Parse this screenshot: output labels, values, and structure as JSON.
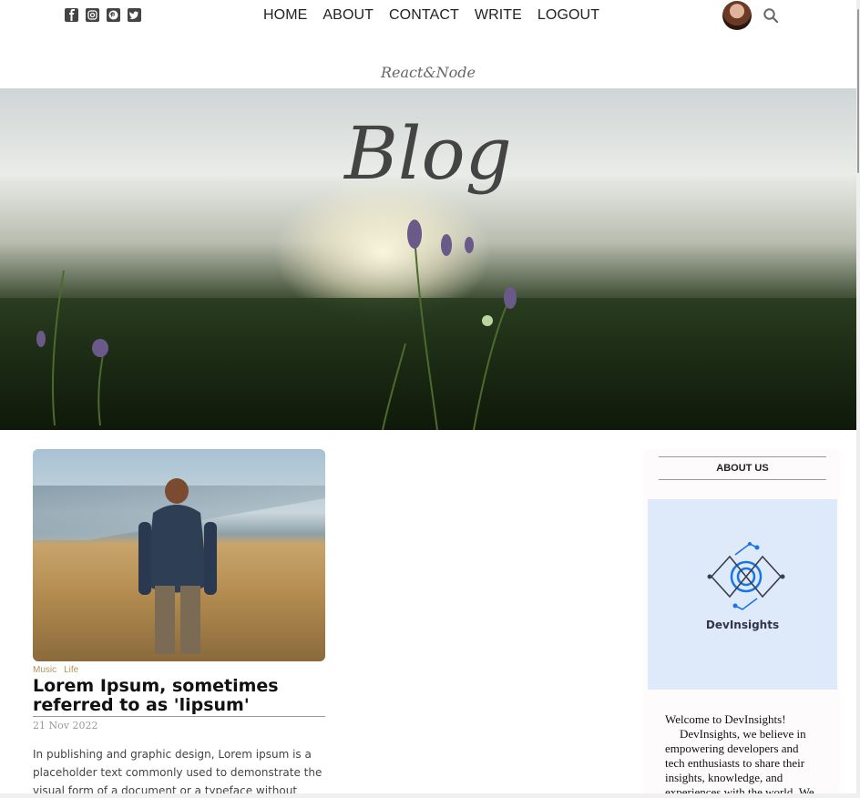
{
  "social": {
    "icons": [
      "facebook-icon",
      "instagram-icon",
      "pinterest-icon",
      "twitter-icon"
    ]
  },
  "nav": {
    "items": [
      "HOME",
      "ABOUT",
      "CONTACT",
      "WRITE",
      "LOGOUT"
    ]
  },
  "header": {
    "subtitle": "React&Node",
    "title": "Blog"
  },
  "post": {
    "categories": [
      "Music",
      "Life"
    ],
    "title": "Lorem Ipsum, sometimes referred to as 'lipsum'",
    "date": "21 Nov 2022",
    "description": "In publishing and graphic design, Lorem ipsum is a placeholder text commonly used to demonstrate the visual form of a document or a typeface without relying"
  },
  "sidebar": {
    "title": "ABOUT US",
    "logo_text": "DevInsights",
    "welcome": "Welcome to DevInsights!",
    "body": "DevInsights, we believe in empowering developers and tech enthusiasts to share their insights, knowledge, and experiences with the world. We"
  },
  "colors": {
    "category": "#b39656",
    "sidebar_image_bg": "#deeafa",
    "logo_accent": "#1a73e8"
  }
}
